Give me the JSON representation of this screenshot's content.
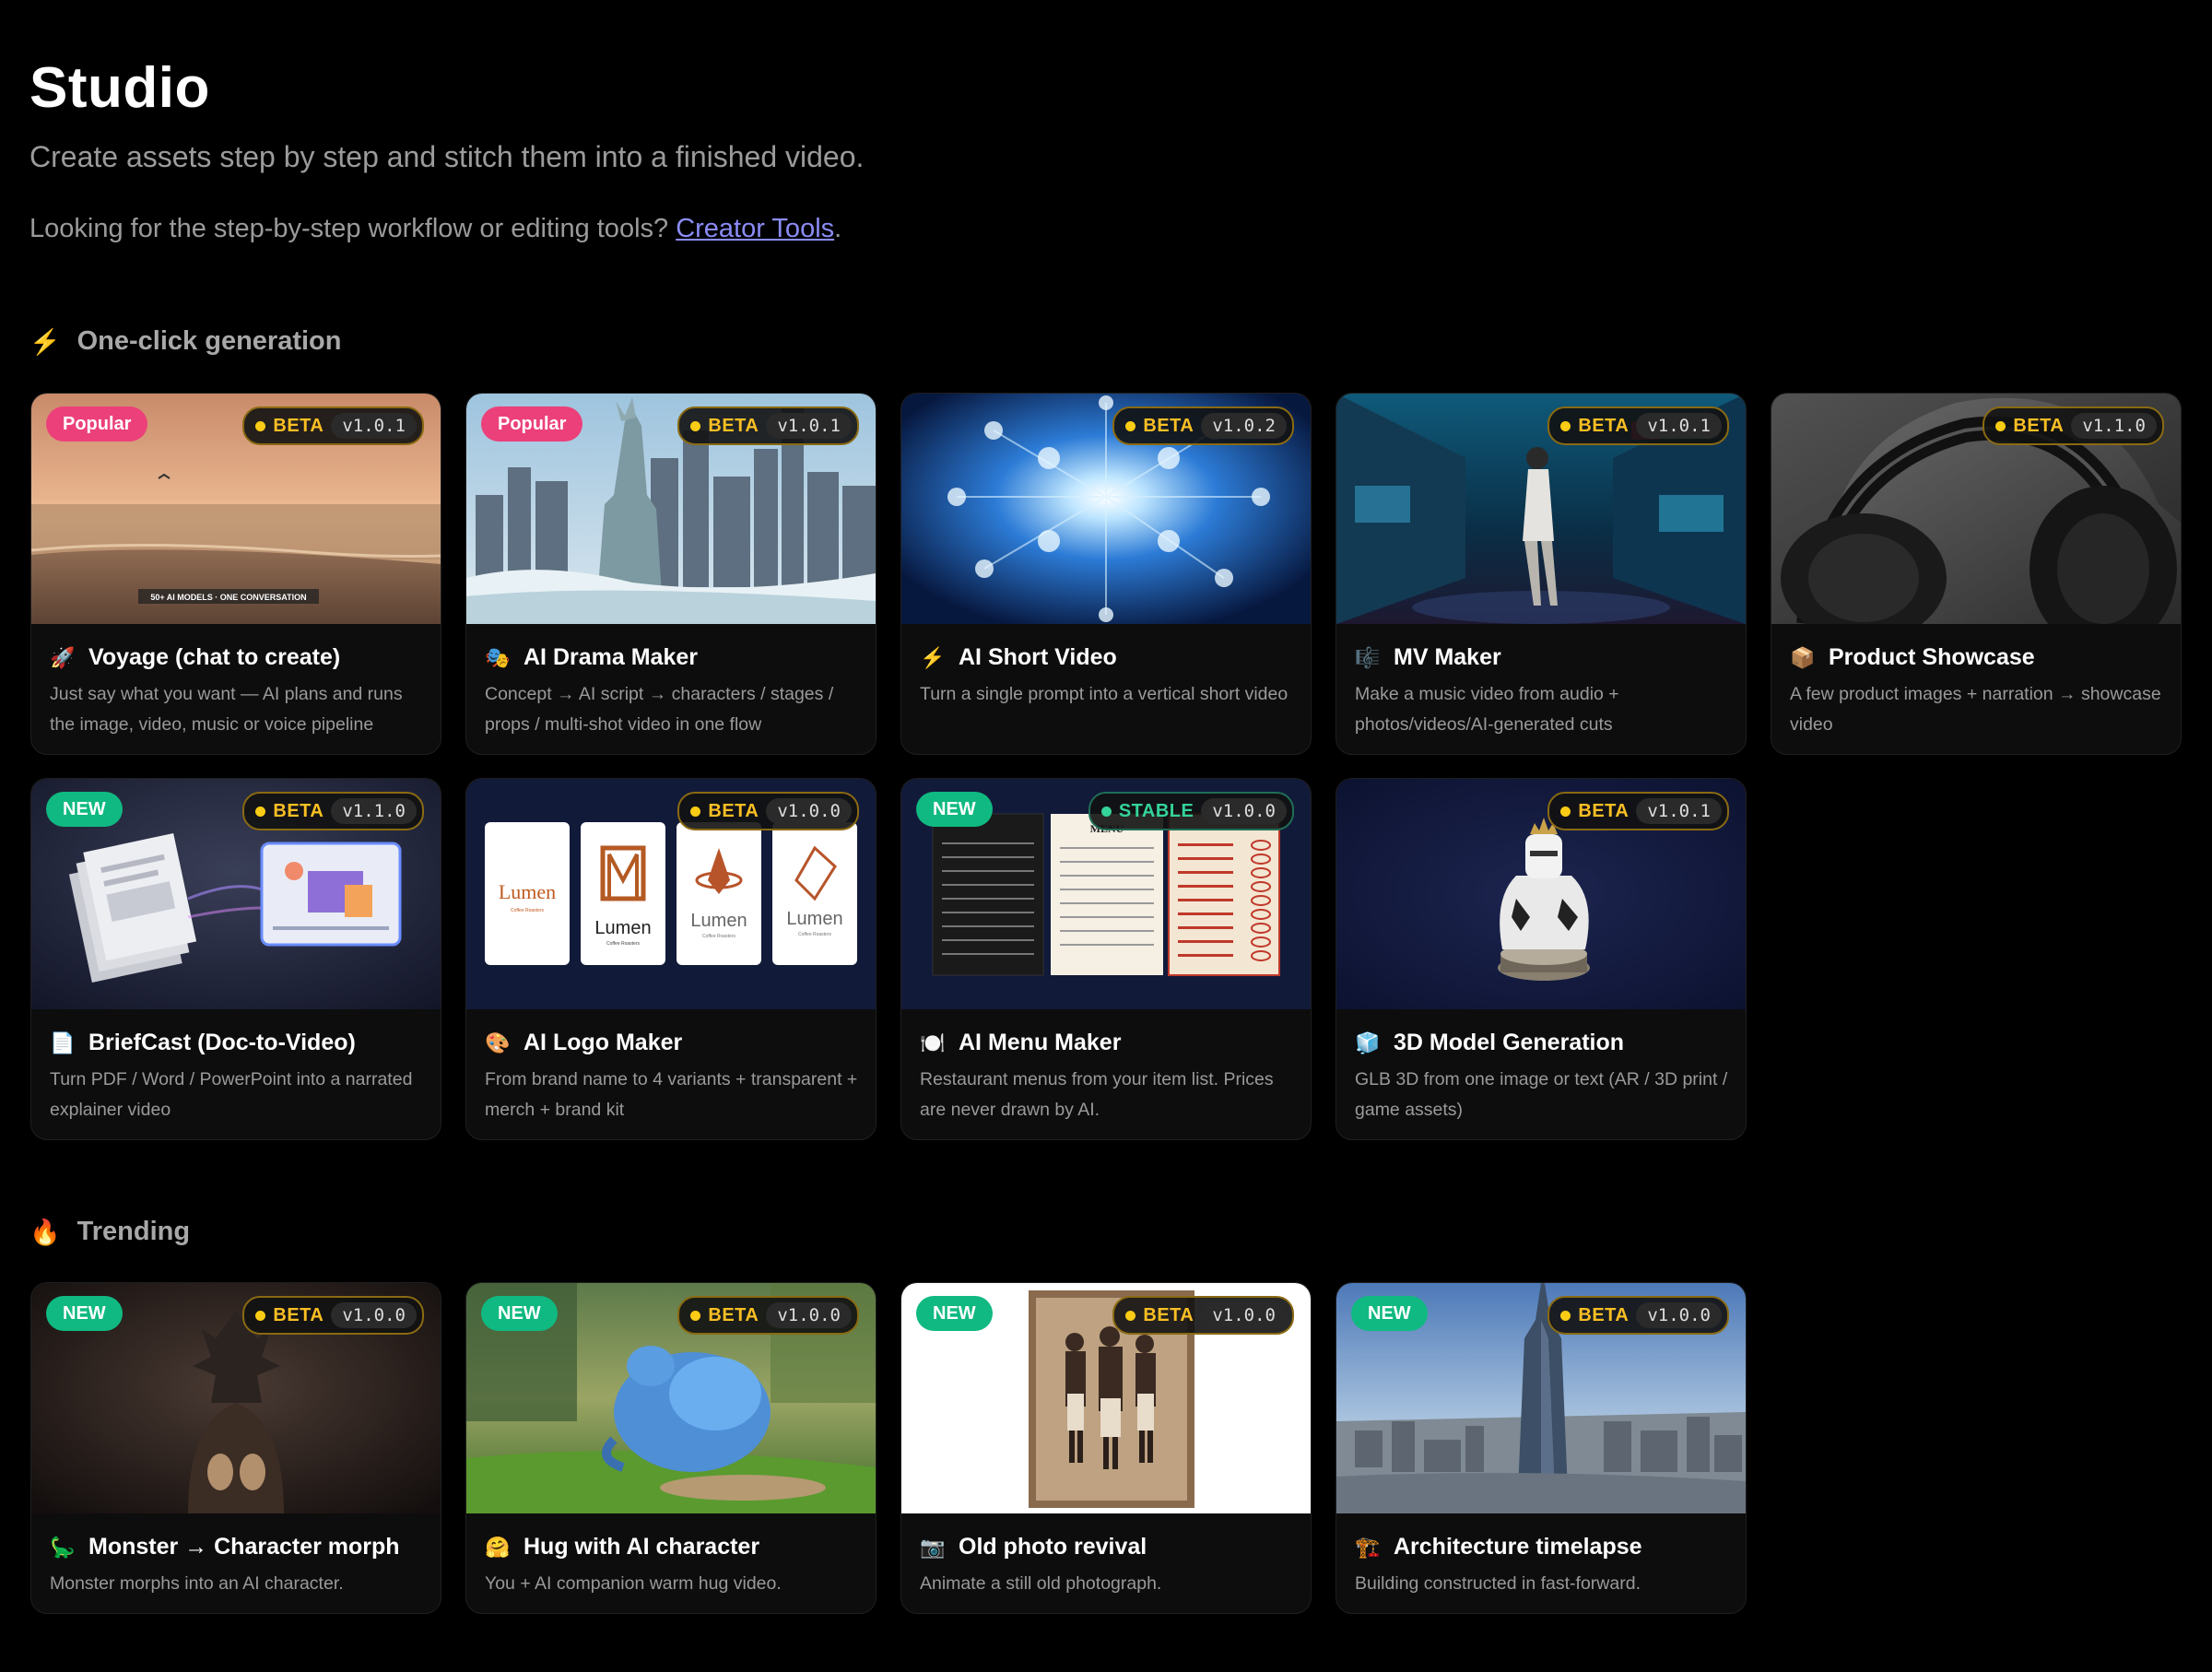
{
  "header": {
    "title": "Studio",
    "subtitle": "Create assets step by step and stitch them into a finished video.",
    "hint_prefix": "Looking for the step-by-step workflow or editing tools? ",
    "hint_link": "Creator Tools",
    "hint_suffix": "."
  },
  "sections": [
    {
      "icon": "lightning-icon",
      "emoji": "⚡",
      "title": "One-click generation"
    },
    {
      "icon": "fire-icon",
      "emoji": "🔥",
      "title": "Trending"
    }
  ],
  "cards": [
    {
      "tag": "Popular",
      "status": "BETA",
      "version": "v1.0.1",
      "icon": "rocket-icon",
      "emoji": "🚀",
      "title": "Voyage (chat to create)",
      "desc": "Just say what you want — AI plans and runs the image, video, music or voice pipeline",
      "overlay": "50+ AI MODELS  ·  ONE CONVERSATION"
    },
    {
      "tag": "Popular",
      "status": "BETA",
      "version": "v1.0.1",
      "icon": "drama-masks-icon",
      "emoji": "🎭",
      "title": "AI Drama Maker",
      "desc": "Concept → AI script → characters / stages / props / multi-shot video in one flow"
    },
    {
      "tag": "",
      "status": "BETA",
      "version": "v1.0.2",
      "icon": "lightning-icon",
      "emoji": "⚡",
      "title": "AI Short Video",
      "desc": "Turn a single prompt into a vertical short video"
    },
    {
      "tag": "",
      "status": "BETA",
      "version": "v1.0.1",
      "icon": "music-score-icon",
      "emoji": "🎼",
      "title": "MV Maker",
      "desc": "Make a music video from audio + photos/videos/AI-generated cuts"
    },
    {
      "tag": "",
      "status": "BETA",
      "version": "v1.1.0",
      "icon": "package-icon",
      "emoji": "📦",
      "title": "Product Showcase",
      "desc": "A few product images + narration → showcase video"
    },
    {
      "tag": "NEW",
      "status": "BETA",
      "version": "v1.1.0",
      "icon": "document-icon",
      "emoji": "📄",
      "title": "BriefCast (Doc-to-Video)",
      "desc": "Turn PDF / Word / PowerPoint into a narrated explainer video"
    },
    {
      "tag": "",
      "status": "BETA",
      "version": "v1.0.0",
      "icon": "palette-icon",
      "emoji": "🎨",
      "title": "AI Logo Maker",
      "desc": "From brand name to 4 variants + transparent + merch + brand kit",
      "logo_text": "Lumen",
      "logo_sub": "Coffee Roasters"
    },
    {
      "tag": "NEW",
      "status": "STABLE",
      "version": "v1.0.0",
      "icon": "plate-icon",
      "emoji": "🍽️",
      "title": "AI Menu Maker",
      "desc": "Restaurant menus from your item list. Prices are never drawn by AI.",
      "menu_heading": "MENU"
    },
    {
      "tag": "",
      "status": "BETA",
      "version": "v1.0.1",
      "icon": "cube-icon",
      "emoji": "🧊",
      "title": "3D Model Generation",
      "desc": "GLB 3D from one image or text (AR / 3D print / game assets)"
    },
    {
      "tag": "NEW",
      "status": "BETA",
      "version": "v1.0.0",
      "icon": "dinosaur-icon",
      "emoji": "🦕",
      "title": "Monster → Character morph",
      "desc": "Monster morphs into an AI character."
    },
    {
      "tag": "NEW",
      "status": "BETA",
      "version": "v1.0.0",
      "icon": "hug-icon",
      "emoji": "🤗",
      "title": "Hug with AI character",
      "desc": "You + AI companion warm hug video."
    },
    {
      "tag": "NEW",
      "status": "BETA",
      "version": "v1.0.0",
      "icon": "camera-icon",
      "emoji": "📷",
      "title": "Old photo revival",
      "desc": "Animate a still old photograph."
    },
    {
      "tag": "NEW",
      "status": "BETA",
      "version": "v1.0.0",
      "icon": "crane-icon",
      "emoji": "🏗️",
      "title": "Architecture timelapse",
      "desc": "Building constructed in fast-forward."
    }
  ]
}
